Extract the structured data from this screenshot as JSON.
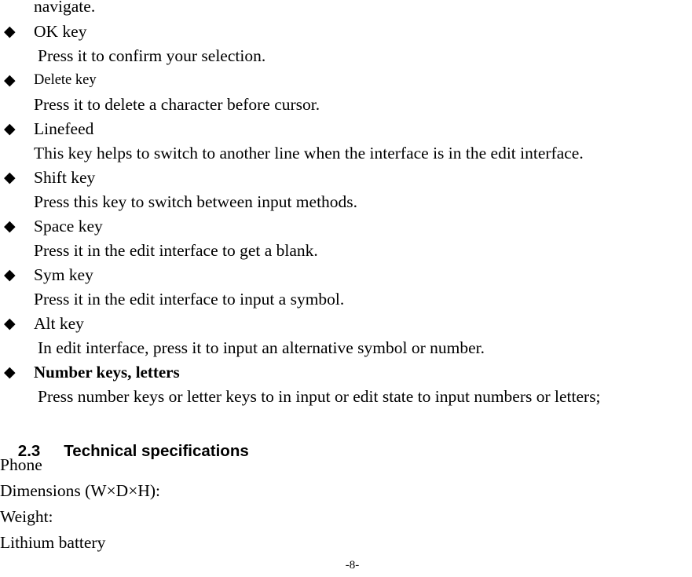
{
  "page": {
    "continuation_text": "navigate.",
    "bullet_marker": "◆",
    "footer_page_number": "-8-"
  },
  "bullets": [
    {
      "label": "OK key",
      "label_style": "normal",
      "description": " Press it to confirm your selection.",
      "description_indented": true
    },
    {
      "label": "Delete key",
      "label_style": "small",
      "description": "Press it to delete a character before cursor.",
      "description_indented": false
    },
    {
      "label": "Linefeed",
      "label_style": "normal",
      "description": "This key helps to switch to another line when the interface is in the edit interface.",
      "description_indented": false
    },
    {
      "label": "Shift key",
      "label_style": "normal",
      "description": "Press this key to switch between input methods.",
      "description_indented": false
    },
    {
      "label": "Space key",
      "label_style": "normal",
      "description": "Press it in the edit interface to get a blank.",
      "description_indented": false
    },
    {
      "label": "Sym key",
      "label_style": "normal",
      "description": "Press it in the edit interface to input a symbol.",
      "description_indented": false
    },
    {
      "label": "Alt key",
      "label_style": "normal",
      "description": " In edit interface, press it to input an alternative symbol or number.",
      "description_indented": true
    },
    {
      "label": "Number keys, letters",
      "label_style": "bold",
      "description": " Press number keys or letter keys to in input or edit state to input numbers or letters;",
      "description_indented": true
    }
  ],
  "section": {
    "number": "2.3",
    "title": "Technical specifications"
  },
  "specifications": [
    "Phone",
    "Dimensions (W×D×H):",
    "Weight:",
    "Lithium battery"
  ]
}
